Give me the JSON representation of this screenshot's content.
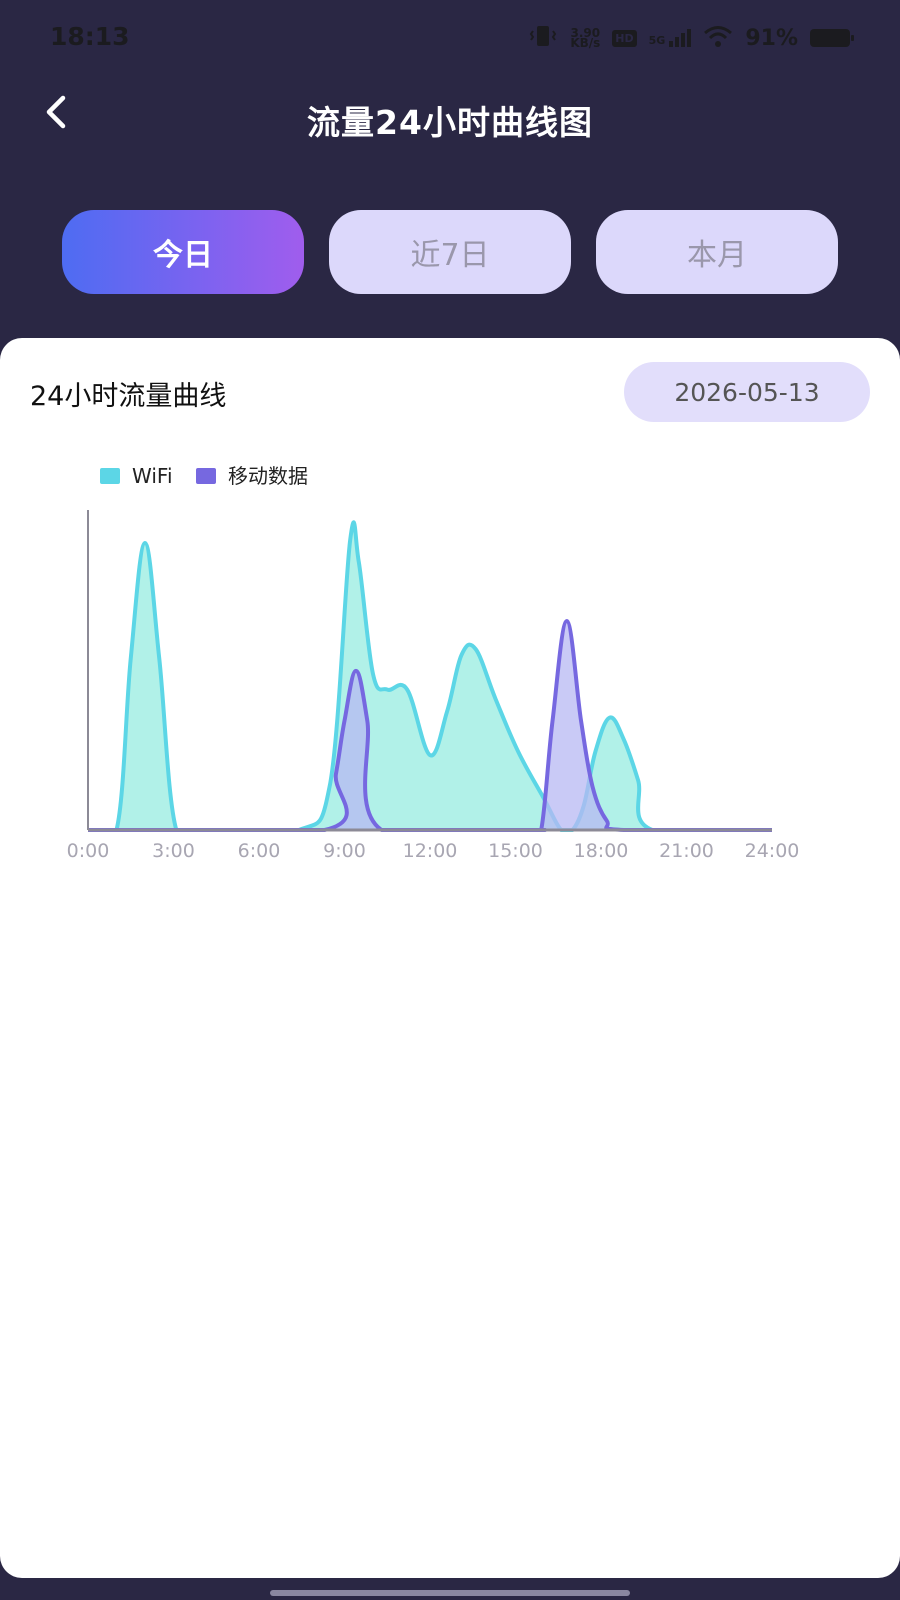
{
  "status": {
    "time": "18:13",
    "speed_value": "3.90",
    "speed_unit": "KB/s",
    "hd_label": "HD",
    "network": "5G",
    "battery": "91%"
  },
  "header": {
    "title": "流量24小时曲线图"
  },
  "tabs": [
    {
      "label": "今日",
      "active": true
    },
    {
      "label": "近7日",
      "active": false
    },
    {
      "label": "本月",
      "active": false
    }
  ],
  "card": {
    "title": "24小时流量曲线",
    "date": "2026-05-13"
  },
  "colors": {
    "wifi": "#5cd6e6",
    "wifi_fill": "#a9efe6",
    "mobile": "#7668e0",
    "mobile_fill": "#b7b8f3",
    "background": "#2a2744",
    "accent": "#7a63f0"
  },
  "chart_data": {
    "type": "area",
    "x_tick_labels": [
      "0:00",
      "3:00",
      "6:00",
      "9:00",
      "12:00",
      "15:00",
      "18:00",
      "21:00",
      "24:00"
    ],
    "xlim": [
      0,
      24
    ],
    "ylim": [
      0,
      100
    ],
    "grid": false,
    "legend_position": "top-left",
    "series": [
      {
        "name": "WiFi",
        "x": [
          0,
          1.0,
          1.5,
          2.0,
          2.5,
          3.1,
          4.2,
          7.4,
          8.5,
          9.2,
          9.5,
          10.0,
          10.5,
          11.2,
          12.0,
          12.6,
          13.1,
          13.6,
          14.3,
          15.1,
          16.0,
          16.6,
          17.0,
          17.4,
          17.8,
          18.3,
          18.8,
          19.3,
          19.8,
          24
        ],
        "values": [
          0,
          0,
          55,
          92,
          55,
          0,
          0,
          0,
          15,
          93,
          86,
          50,
          45,
          45,
          24,
          38,
          56,
          58,
          42,
          25,
          10,
          0,
          0,
          8,
          25,
          36,
          29,
          16,
          0,
          0
        ]
      },
      {
        "name": "移动数据",
        "x": [
          0,
          8.3,
          8.7,
          9.0,
          9.4,
          9.8,
          10.3,
          15.5,
          15.9,
          16.3,
          16.8,
          17.3,
          17.7,
          18.2,
          18.8,
          24
        ],
        "values": [
          0,
          0,
          18,
          35,
          51,
          35,
          0,
          0,
          0,
          35,
          67,
          35,
          14,
          3,
          0,
          0
        ]
      }
    ]
  }
}
